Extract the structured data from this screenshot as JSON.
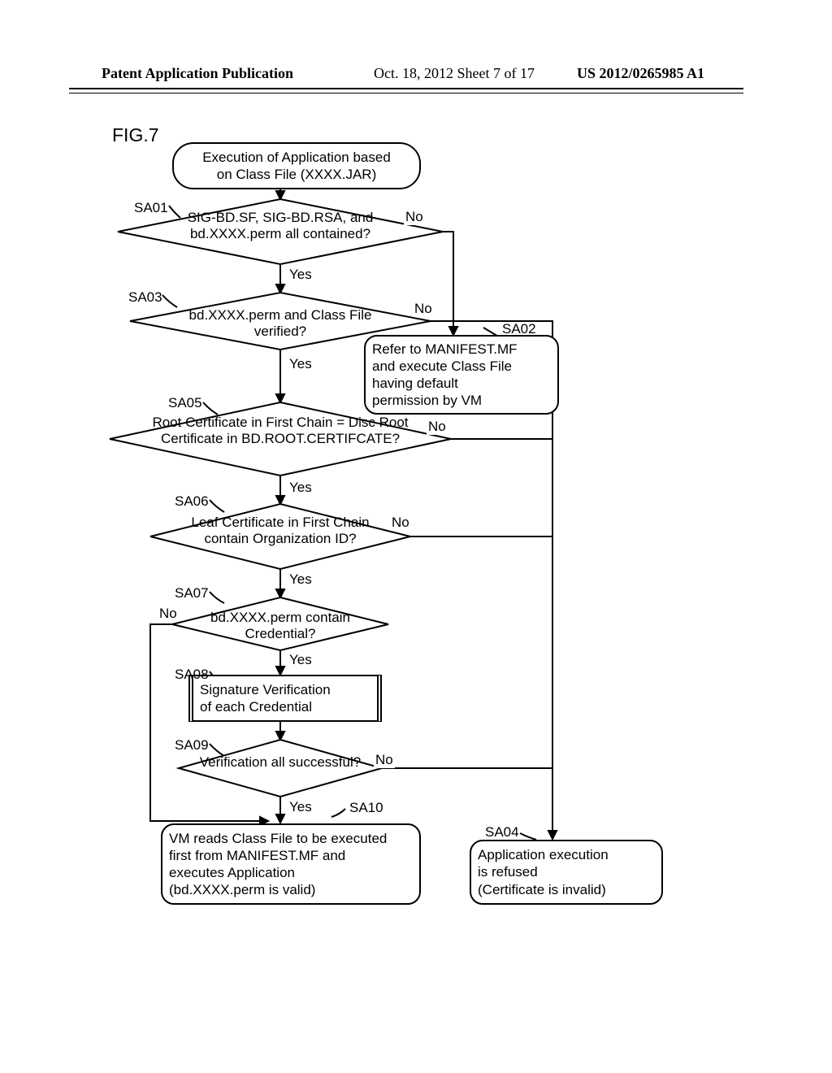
{
  "header": {
    "left": "Patent Application Publication",
    "mid": "Oct. 18, 2012  Sheet 7 of 17",
    "right": "US 2012/0265985 A1"
  },
  "fig": "FIG.7",
  "nodes": {
    "start": "Execution of Application based\non Class File (XXXX.JAR)",
    "sa01": "SIG-BD.SF,\nSIG-BD.RSA, and bd.XXXX.perm\nall contained?",
    "sa03": "bd.XXXX.perm and\nClass File verified?",
    "sa05": "Root Certificate in\nFirst Chain = Disc Root Certificate in\nBD.ROOT.CERTIFCATE?",
    "sa06": "Leaf Certificate in\nFirst Chain contain\nOrganization ID?",
    "sa07": "bd.XXXX.perm\ncontain Credential?",
    "sa08": "Signature Verification\nof each Credential",
    "sa09": "Verification all\nsuccessful?",
    "sa02": "Refer to MANIFEST.MF\nand execute Class File\nhaving default\npermission by VM",
    "sa10": "VM reads Class File to be executed\nfirst from MANIFEST.MF and\nexecutes Application\n(bd.XXXX.perm is valid)",
    "sa04": "Application execution\nis refused\n(Certificate is invalid)"
  },
  "step_labels": {
    "sa01": "SA01",
    "sa02": "SA02",
    "sa03": "SA03",
    "sa04": "SA04",
    "sa05": "SA05",
    "sa06": "SA06",
    "sa07": "SA07",
    "sa08": "SA08",
    "sa09": "SA09",
    "sa10": "SA10"
  },
  "edge_labels": {
    "yes": "Yes",
    "no": "No"
  }
}
